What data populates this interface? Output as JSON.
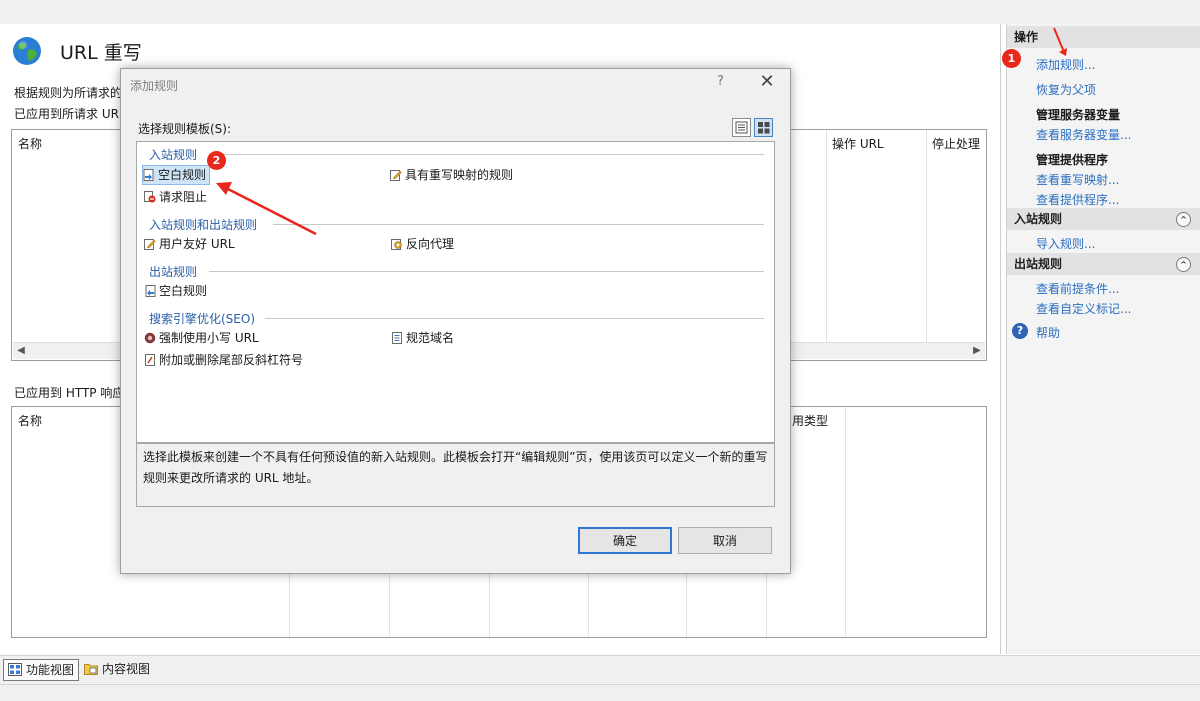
{
  "page": {
    "title": "URL 重写",
    "description": "根据规则为所请求的",
    "inbound_label": "已应用到所请求 URL",
    "outbound_label": "已应用到 HTTP 响应"
  },
  "grid_inbound": {
    "columns": [
      "名称",
      "操作 URL",
      "停止处理"
    ]
  },
  "grid_outbound": {
    "columns": [
      "名称",
      "用类型"
    ]
  },
  "bottom_tabs": [
    {
      "label": "功能视图"
    },
    {
      "label": "内容视图"
    }
  ],
  "actions": {
    "header": "操作",
    "add_rule": "添加规则...",
    "revert_parent": "恢复为父项",
    "server_vars_title": "管理服务器变量",
    "view_server_vars": "查看服务器变量...",
    "providers_title": "管理提供程序",
    "view_rewrite_maps": "查看重写映射...",
    "view_providers": "查看提供程序...",
    "inbound_header": "入站规则",
    "import_rules": "导入规则...",
    "outbound_header": "出站规则",
    "view_preconditions": "查看前提条件...",
    "view_custom_tags": "查看自定义标记...",
    "help": "帮助",
    "help_icon": "?",
    "collapse_icon": "^"
  },
  "annotations": {
    "badge1": "1",
    "badge2": "2",
    "color": "#e8281c"
  },
  "dialog": {
    "title": "添加规则",
    "help_glyph": "?",
    "close_glyph": "✕",
    "select_label": "选择规则模板(S):",
    "groups": {
      "inbound": "入站规则",
      "inbound_outbound": "入站规则和出站规则",
      "outbound": "出站规则",
      "seo": "搜索引擎优化(SEO)"
    },
    "templates": {
      "blank_inbound": "空白规则",
      "rewrite_map": "具有重写映射的规则",
      "request_block": "请求阻止",
      "user_friendly": "用户友好 URL",
      "reverse_proxy": "反向代理",
      "blank_outbound": "空白规则",
      "lowercase": "强制使用小写 URL",
      "canonical": "规范域名",
      "trailing_slash": "附加或删除尾部反斜杠符号"
    },
    "description": "选择此模板来创建一个不具有任何预设值的新入站规则。此模板会打开“编辑规则”页，使用该页可以定义一个新的重写规则来更改所请求的 URL 地址。",
    "ok": "确定",
    "cancel": "取消"
  }
}
